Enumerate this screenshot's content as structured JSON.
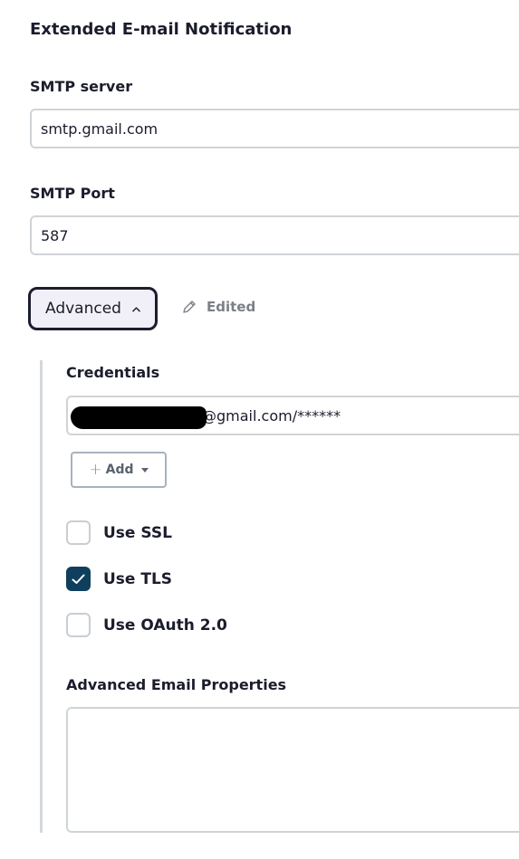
{
  "section": {
    "title": "Extended E-mail Notification"
  },
  "smtp_server": {
    "label": "SMTP server",
    "value": "smtp.gmail.com"
  },
  "smtp_port": {
    "label": "SMTP Port",
    "value": "587"
  },
  "advanced": {
    "button_label": "Advanced",
    "edited_label": "Edited"
  },
  "credentials": {
    "label": "Credentials",
    "value_visible": "@gmail.com/******",
    "add_label": "Add"
  },
  "checkboxes": [
    {
      "label": "Use SSL",
      "checked": false
    },
    {
      "label": "Use TLS",
      "checked": true
    },
    {
      "label": "Use OAuth 2.0",
      "checked": false
    }
  ],
  "advanced_email_properties": {
    "label": "Advanced Email Properties",
    "value": ""
  },
  "colors": {
    "checked_fill": "#0f3f5c",
    "border": "#cfd4d8",
    "advanced_button_bg": "#f1f0f8",
    "edited_text": "#7b7f86"
  }
}
